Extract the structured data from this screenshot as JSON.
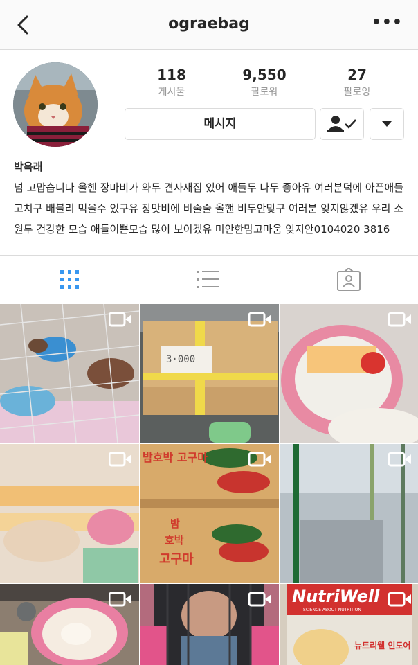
{
  "header": {
    "username": "ograebag"
  },
  "stats": [
    {
      "value": "118",
      "label": "게시물"
    },
    {
      "value": "9,550",
      "label": "팔로워"
    },
    {
      "value": "27",
      "label": "팔로잉"
    }
  ],
  "actions": {
    "message_label": "메시지"
  },
  "profile": {
    "name": "박옥래",
    "bio": "넘 고맙습니다 올핸 장마비가 와두 견사새집 있어 애들두 나두 좋아유 여러분덕에 아픈애들고치구 배블리 먹을수 있구유 장맛비에 비줄줄 올핸 비두안맞구 여러분 잊지않겠유 우리 소원두 건강한 모습 애들이쁜모습 많이 보이겠유 미안한맘고마움 잊지안0104020 3816"
  },
  "tabs": [
    "grid-view",
    "list-view",
    "tagged-view"
  ],
  "posts": [
    {
      "type": "video"
    },
    {
      "type": "video",
      "text": "3·000"
    },
    {
      "type": "video"
    },
    {
      "type": "video"
    },
    {
      "type": "video",
      "text_top": "밤호박 고구마",
      "text_bottom_1": "밤",
      "text_bottom_2": "호박",
      "text_bottom_3": "고구마"
    },
    {
      "type": "video"
    },
    {
      "type": "video"
    },
    {
      "type": "video"
    },
    {
      "type": "video",
      "brand": "NutriWell",
      "tagline": "SCIENCE ABOUT NUTRITION",
      "product": "뉴트리웰 인도어"
    }
  ],
  "colors": {
    "accent_blue": "#3897f0",
    "border": "#dbdbdb",
    "muted": "#999999"
  }
}
